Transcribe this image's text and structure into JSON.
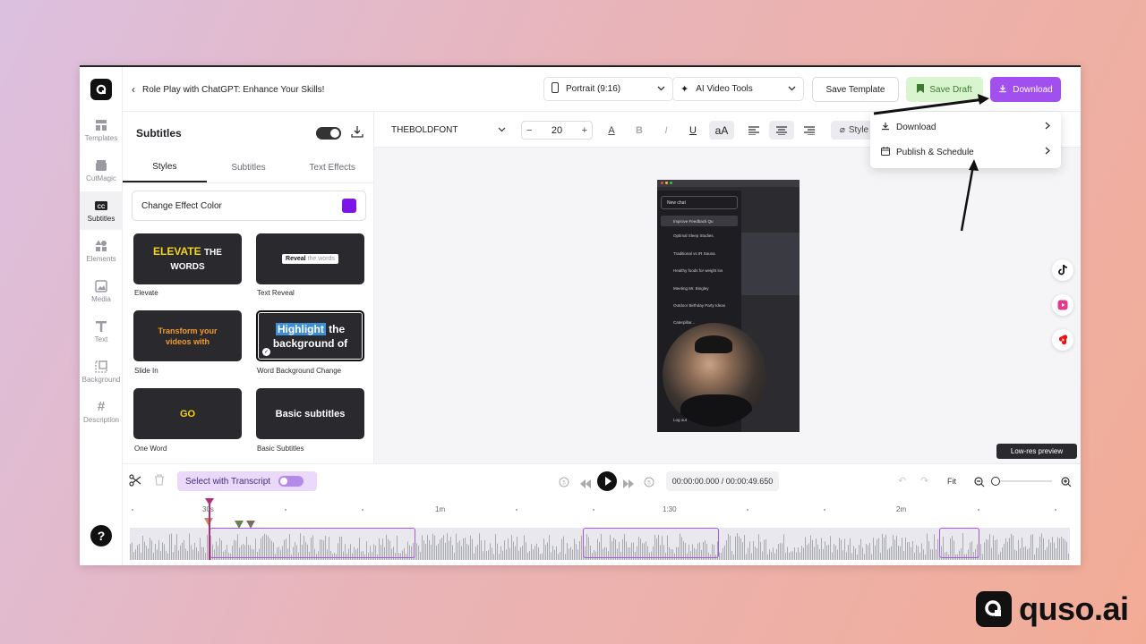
{
  "project": {
    "title": "Role Play with ChatGPT: Enhance Your Skills!"
  },
  "rail": {
    "items": [
      {
        "label": "Templates",
        "icon": "templates-icon"
      },
      {
        "label": "CutMagic",
        "icon": "cutmagic-icon"
      },
      {
        "label": "Subtitles",
        "icon": "subtitles-icon"
      },
      {
        "label": "Elements",
        "icon": "elements-icon"
      },
      {
        "label": "Media",
        "icon": "media-icon"
      },
      {
        "label": "Text",
        "icon": "text-icon"
      },
      {
        "label": "Background",
        "icon": "background-icon"
      },
      {
        "label": "Description",
        "icon": "description-icon"
      }
    ],
    "help": "?"
  },
  "topbar": {
    "aspect": "Portrait (9:16)",
    "ai_tools": "AI Video Tools",
    "save_template": "Save Template",
    "save_draft": "Save Draft",
    "download": "Download"
  },
  "menu": {
    "items": [
      {
        "label": "Download"
      },
      {
        "label": "Publish & Schedule"
      }
    ]
  },
  "panel": {
    "title": "Subtitles",
    "tabs": [
      "Styles",
      "Subtitles",
      "Text Effects"
    ],
    "effect_color_label": "Change Effect Color",
    "effect_color": "#7b16e8",
    "styles": [
      {
        "label": "Elevate",
        "preview1": "ELEVATE",
        "preview2": "THE",
        "preview3": "WORDS"
      },
      {
        "label": "Text Reveal",
        "preview1": "Reveal",
        "preview2": "the words"
      },
      {
        "label": "Slide In",
        "preview1": "Transform your",
        "preview2": "videos with"
      },
      {
        "label": "Word Background Change",
        "preview1": "Highlight",
        "preview2": "the",
        "preview3": "background of"
      },
      {
        "label": "One Word",
        "preview1": "GO"
      },
      {
        "label": "Basic Subtitles",
        "preview1": "Basic subtitles"
      }
    ]
  },
  "toolbar": {
    "font": "THEBOLDFONT",
    "size": "20",
    "style_label": "Style",
    "case_label": "aA",
    "color_letter": "A",
    "bold": "B",
    "italic": "I",
    "underline": "U"
  },
  "preview": {
    "chat_items": [
      "New chat",
      "Improve Feedback Qu",
      "Optimal Sleep Studies.",
      "Traditional vs IR Sauna",
      "Healthy foods for weight los",
      "Meeting Mr. Bingley",
      "Outdoor Birthday Party Ideas",
      "Caterpillar..."
    ],
    "logout": "Log out",
    "lowres": "Low-res preview"
  },
  "timeline": {
    "select_transcript": "Select with Transcript",
    "time": "00:00:00.000 / 00:00:49.650",
    "fit": "Fit",
    "ruler": [
      {
        "label": "30s"
      },
      {
        "label": "1m"
      },
      {
        "label": "1:30"
      },
      {
        "label": "2m"
      }
    ]
  },
  "brand": {
    "name": "quso.ai"
  },
  "colors": {
    "accent": "#a24ff0",
    "draft_green": "#d9f5cf",
    "playhead": "#b02e7a"
  }
}
